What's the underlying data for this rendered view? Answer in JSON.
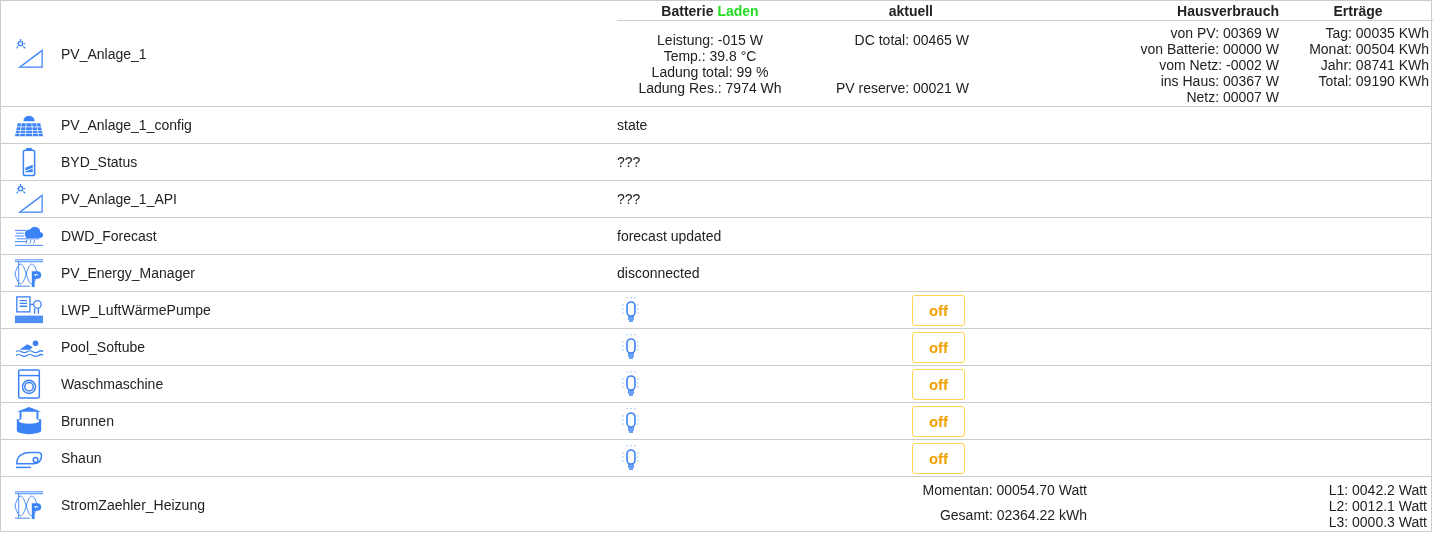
{
  "rows": [
    {
      "kind": "pv",
      "name": "PV_Anlage_1",
      "battery": {
        "title": "Batterie",
        "state": "Laden",
        "lines": [
          "Leistung: -015 W",
          "Temp.: 39.8 °C",
          "Ladung total: 99 %",
          "Ladung Res.: 7974 Wh"
        ]
      },
      "current": {
        "title": "aktuell",
        "top": "DC total: 00465 W",
        "bottom": "PV reserve: 00021 W"
      },
      "house": {
        "title": "Hausverbrauch",
        "lines": [
          "von PV: 00369 W",
          "von Batterie: 00000 W",
          "vom Netz: -0002 W",
          "ins Haus: 00367 W",
          "Netz: 00007 W"
        ]
      },
      "yield": {
        "title": "Erträge",
        "lines": [
          "Tag: 00035 KWh",
          "Monat: 00504 KWh",
          "Jahr: 08741 KWh",
          "Total: 09190 KWh"
        ]
      }
    },
    {
      "kind": "status",
      "name": "PV_Anlage_1_config",
      "value": "state"
    },
    {
      "kind": "status",
      "name": "BYD_Status",
      "value": "???"
    },
    {
      "kind": "status",
      "name": "PV_Anlage_1_API",
      "value": "???"
    },
    {
      "kind": "status",
      "name": "DWD_Forecast",
      "value": "forecast updated"
    },
    {
      "kind": "status",
      "name": "PV_Energy_Manager",
      "value": "disconnected"
    },
    {
      "kind": "switch",
      "name": "LWP_LuftWärmePumpe",
      "on": false,
      "button": "off"
    },
    {
      "kind": "switch",
      "name": "Pool_Softube",
      "on": false,
      "button": "off"
    },
    {
      "kind": "switch",
      "name": "Waschmaschine",
      "on": false,
      "button": "off"
    },
    {
      "kind": "switch",
      "name": "Brunnen",
      "on": false,
      "button": "off"
    },
    {
      "kind": "switch",
      "name": "Shaun",
      "on": false,
      "button": "off"
    },
    {
      "kind": "meter",
      "name": "StromZaehler_Heizung",
      "momentary": "Momentan: 00054.70 Watt",
      "total": "Gesamt: 02364.22 kWh",
      "phases": [
        "L1: 0042.2 Watt",
        "L2: 0012.1 Watt",
        "L3: 0000.3 Watt"
      ]
    }
  ]
}
